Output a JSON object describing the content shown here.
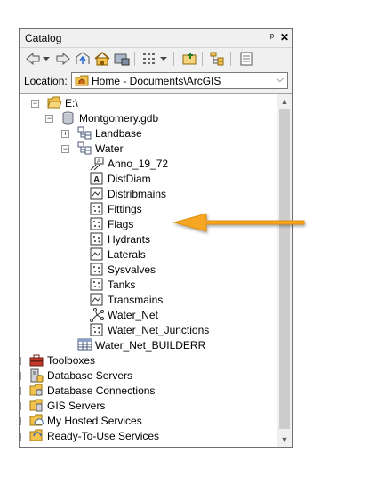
{
  "window": {
    "title": "Catalog",
    "pin_glyph": "ᵖ",
    "close_glyph": "✕"
  },
  "toolbar": {
    "buttons": [
      "back-icon",
      "back-dropdown-icon",
      "forward-icon",
      "up-one-level-icon",
      "home-icon",
      "connect-folder-icon",
      "view-options-icon",
      "view-dropdown-icon",
      "launch-arcmap-icon",
      "toggle-contents-icon",
      "options-icon"
    ]
  },
  "location": {
    "label": "Location:",
    "value": "Home - Documents\\ArcGIS"
  },
  "tree": {
    "nodes": [
      {
        "label": "E:\\",
        "icon": "folder-open-icon",
        "expander": "−"
      },
      {
        "label": "Montgomery.gdb",
        "icon": "geodatabase-icon",
        "expander": "−"
      },
      {
        "label": "Landbase",
        "icon": "feature-dataset-icon",
        "expander": "+"
      },
      {
        "label": "Water",
        "icon": "feature-dataset-icon",
        "expander": "−"
      },
      {
        "label": "Anno_19_72",
        "icon": "annotation-class-icon"
      },
      {
        "label": "DistDiam",
        "icon": "dimension-class-icon"
      },
      {
        "label": "Distribmains",
        "icon": "line-feature-class-icon"
      },
      {
        "label": "Fittings",
        "icon": "point-feature-class-icon"
      },
      {
        "label": "Flags",
        "icon": "point-feature-class-icon"
      },
      {
        "label": "Hydrants",
        "icon": "point-feature-class-icon"
      },
      {
        "label": "Laterals",
        "icon": "line-feature-class-icon"
      },
      {
        "label": "Sysvalves",
        "icon": "point-feature-class-icon"
      },
      {
        "label": "Tanks",
        "icon": "point-feature-class-icon"
      },
      {
        "label": "Transmains",
        "icon": "line-feature-class-icon"
      },
      {
        "label": "Water_Net",
        "icon": "geometric-network-icon"
      },
      {
        "label": "Water_Net_Junctions",
        "icon": "point-feature-class-icon"
      },
      {
        "label": "Water_Net_BUILDERR",
        "icon": "table-icon"
      },
      {
        "label": "Toolboxes",
        "icon": "toolbox-icon",
        "expander": "+"
      },
      {
        "label": "Database Servers",
        "icon": "database-server-icon",
        "expander": "+"
      },
      {
        "label": "Database Connections",
        "icon": "database-connections-icon",
        "expander": "+"
      },
      {
        "label": "GIS Servers",
        "icon": "gis-servers-icon",
        "expander": "+"
      },
      {
        "label": "My Hosted Services",
        "icon": "hosted-services-icon",
        "expander": "+"
      },
      {
        "label": "Ready-To-Use Services",
        "icon": "ready-to-use-services-icon",
        "expander": "+"
      }
    ]
  },
  "scrollbar": {
    "up_glyph": "▲",
    "down_glyph": "▼"
  },
  "annotation": {
    "arrow_color": "#f5a623",
    "points_to": "Flags"
  }
}
